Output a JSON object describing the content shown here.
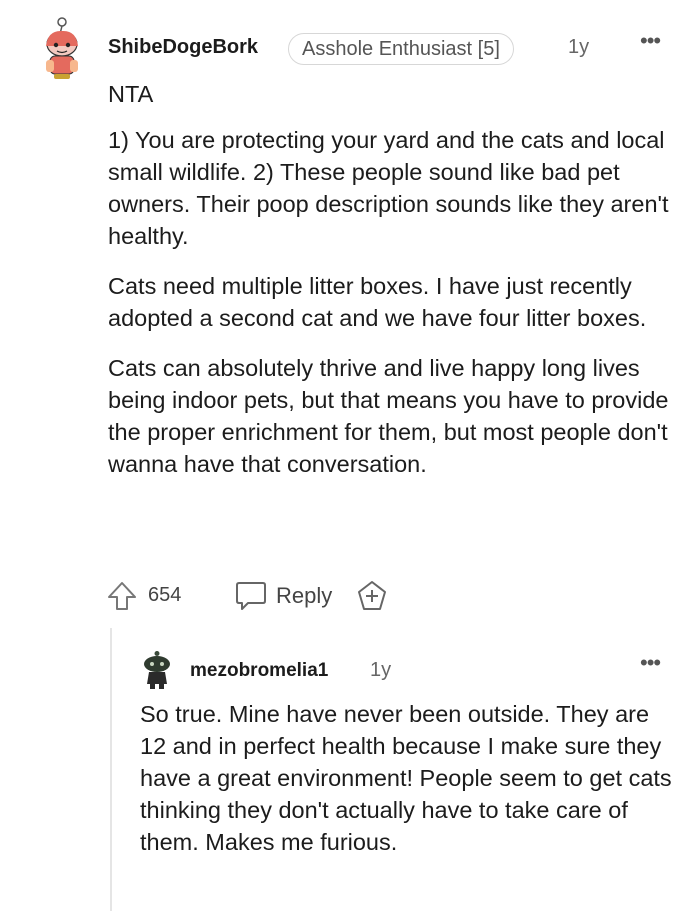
{
  "comment": {
    "username": "ShibeDogeBork",
    "flair": "Asshole Enthusiast [5]",
    "age": "1y",
    "more": "•••",
    "paragraphs": [
      "NTA",
      "1) You are protecting your yard and the cats and local small wildlife. 2) These people sound like bad pet owners. Their poop description sounds like they aren't healthy.",
      "Cats need multiple litter boxes. I have just recently adopted a second cat and we have four litter boxes.",
      "Cats can absolutely thrive and live happy long lives being indoor pets, but that means you have to provide the proper enrichment for them, but most people don't wanna have that conversation."
    ],
    "votes": "654",
    "reply_label": "Reply"
  },
  "reply": {
    "username": "mezobromelia1",
    "age": "1y",
    "more": "•••",
    "text": "So true. Mine have never been outside. They are 12 and in perfect health because I make sure they have a great environment! People seem to get cats thinking they don't actually have to take care of them. Makes me furious."
  },
  "icons": {
    "avatar": "snoo-avatar-icon",
    "reply_avatar": "snoo-dark-avatar-icon",
    "upvote": "upvote-arrow-icon",
    "reply": "speech-bubble-icon",
    "award": "award-plus-icon"
  },
  "colors": {
    "text": "#1c1c1c",
    "meta": "#666666",
    "avatar_accent": "#e46a5e",
    "thread_line": "#e5e5e5"
  }
}
